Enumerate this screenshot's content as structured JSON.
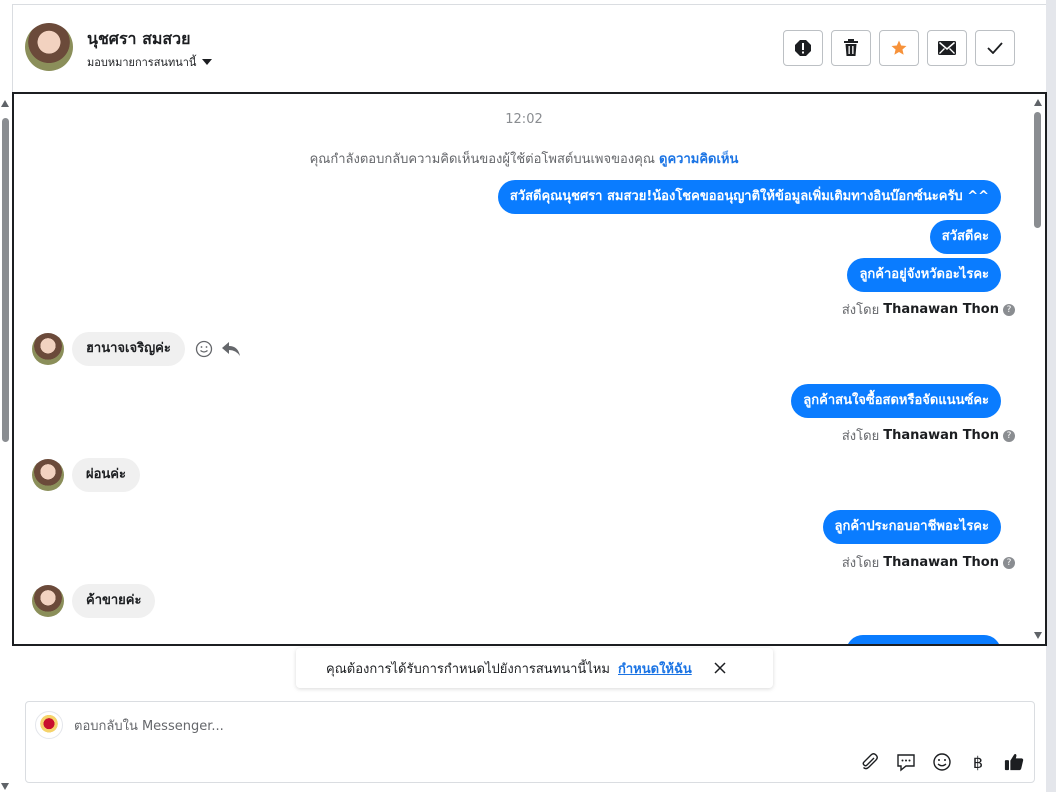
{
  "header": {
    "name": "นุชศรา สมสวย",
    "assign_label": "มอบหมายการสนทนานี้",
    "actions": [
      "report-icon",
      "trash-icon",
      "star-icon",
      "mail-icon",
      "check-icon"
    ],
    "star_color": "#f7923a"
  },
  "conversation": {
    "time": "12:02",
    "reply_note": "คุณกำลังตอบกลับความคิดเห็นของผู้ใช้ต่อโพสต์บนเพจของคุณ",
    "reply_note_link": "ดูความคิดเห็น",
    "outgoing": [
      "สวัสดีคุณนุชศรา สมสวย!น้องโชคขออนุญาติให้ข้อมูลเพิ่มเติมทางอินบ๊อกซ์นะครับ ^^",
      "สวัสดีคะ",
      "ลูกค้าอยู่จังหวัดอะไรคะ",
      "ลูกค้าสนใจซื้อสดหรือจัดแนนซ์คะ",
      "ลูกค้าประกอบอาชีพอะไรคะ"
    ],
    "sent_by_prefix": "ส่งโดย",
    "sent_by_name": "Thanawan Thon",
    "incoming": [
      "ฮานาจเจริญค่ะ",
      "ผ่อนค่ะ",
      "ค้าขายค่ะ"
    ],
    "outgoing_color": "#0a7cff"
  },
  "prompt": {
    "text": "คุณต้องการได้รับการกำหนดไปยังการสนทนานี้ไหม",
    "link": "กำหนดให้ฉัน"
  },
  "composer": {
    "placeholder": "ตอบกลับใน Messenger...",
    "tools": [
      "paperclip-icon",
      "saved-reply-icon",
      "emoji-icon",
      "baht-icon",
      "like-icon"
    ],
    "baht_symbol": "฿"
  }
}
